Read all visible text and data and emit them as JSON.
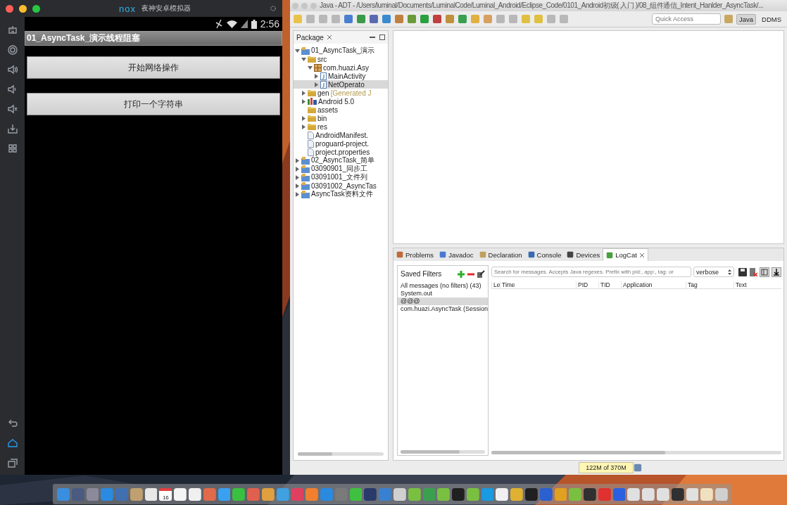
{
  "emulator": {
    "logo": "nox",
    "title": "夜神安卓模拟器",
    "clock": "2:56",
    "app_title": "01_AsyncTask_演示线程阻塞",
    "buttons": [
      "开始网络操作",
      "打印一个字符串"
    ]
  },
  "eclipse": {
    "title": "Java - ADT - /Users/luminal/Documents/LuminalCode/Luminal_Android/Eclipse_Code/0101_Android初级( 入门 )/08_组件通信_Intent_Hanlder_AsyncTask/...",
    "quick_access": {
      "placeholder": "Quick Access"
    },
    "perspectives": [
      {
        "label": "Java",
        "selected": true
      },
      {
        "label": "DDMS",
        "selected": false
      }
    ],
    "package": {
      "tab": "Package",
      "tree": [
        {
          "label": "01_AsyncTask_演示",
          "kind": "project",
          "expanded": true,
          "selected": false,
          "children": [
            {
              "label": "src",
              "kind": "folder",
              "expanded": true,
              "selected": false,
              "children": [
                {
                  "label": "com.huazi.Asy",
                  "kind": "package",
                  "expanded": true,
                  "selected": false,
                  "children": [
                    {
                      "label": "MainActivity",
                      "kind": "java",
                      "expanded": false,
                      "selected": false
                    },
                    {
                      "label": "NetOperato",
                      "kind": "java",
                      "expanded": false,
                      "selected": true
                    }
                  ]
                }
              ]
            },
            {
              "label": "gen",
              "note": "[Generated J",
              "kind": "folder",
              "expanded": false,
              "selected": false
            },
            {
              "label": "Android 5.0",
              "kind": "library",
              "expanded": false,
              "selected": false
            },
            {
              "label": "assets",
              "kind": "folder",
              "selected": false
            },
            {
              "label": "bin",
              "kind": "folder",
              "expanded": false,
              "selected": false
            },
            {
              "label": "res",
              "kind": "folder",
              "expanded": false,
              "selected": false
            },
            {
              "label": "AndroidManifest.",
              "kind": "file",
              "selected": false
            },
            {
              "label": "proguard-project.",
              "kind": "file",
              "selected": false
            },
            {
              "label": "project.properties",
              "kind": "file",
              "selected": false
            }
          ]
        },
        {
          "label": "02_AsyncTask_简单",
          "kind": "project",
          "expanded": false,
          "selected": false
        },
        {
          "label": "03090901_同步工",
          "kind": "project",
          "expanded": false,
          "selected": false
        },
        {
          "label": "03091001_文件列",
          "kind": "project",
          "expanded": false,
          "selected": false
        },
        {
          "label": "03091002_AsyncTas",
          "kind": "project",
          "expanded": false,
          "selected": false
        },
        {
          "label": "AsyncTask资料文件",
          "kind": "project",
          "expanded": false,
          "selected": false
        }
      ]
    },
    "bottom_tabs": [
      {
        "label": "Problems",
        "selected": false
      },
      {
        "label": "Javadoc",
        "selected": false
      },
      {
        "label": "Declaration",
        "selected": false
      },
      {
        "label": "Console",
        "selected": false
      },
      {
        "label": "Devices",
        "selected": false
      },
      {
        "label": "LogCat",
        "selected": true
      }
    ],
    "logcat": {
      "saved_filters_title": "Saved Filters",
      "filters": [
        {
          "label": "All messages (no filters) (43)",
          "selected": false
        },
        {
          "label": "System.out",
          "selected": false
        },
        {
          "label": "@@@",
          "selected": true
        },
        {
          "label": "com.huazi.AsyncTask (Session",
          "selected": false
        }
      ],
      "search": {
        "placeholder": "Search for messages. Accepts Java regexes. Prefix with pid:, app:, tag: or"
      },
      "level": "verbose",
      "columns": [
        "Le",
        "Time",
        "PID",
        "TID",
        "Application",
        "Tag",
        "Text"
      ]
    },
    "status_bar": {
      "memory": "122M of 370M"
    }
  },
  "dock": {
    "calendar_date": "16"
  }
}
